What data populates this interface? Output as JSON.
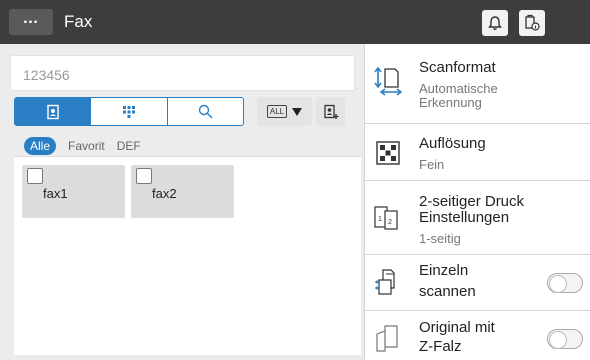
{
  "header": {
    "menu_label": "…",
    "title": "Fax"
  },
  "search": {
    "number_value": "123456"
  },
  "destination_tabs": {
    "all_label": "ALL"
  },
  "filters": [
    "Alle",
    "Favorit",
    "DEF"
  ],
  "destinations": [
    {
      "label": "fax1"
    },
    {
      "label": "fax2"
    }
  ],
  "settings": {
    "scan_format": {
      "title": "Scanformat",
      "value_line1": "Automatische",
      "value_line2": "Erkennung"
    },
    "resolution": {
      "title": "Auflösung",
      "value": "Fein"
    },
    "duplex": {
      "title_line1": "2-seitiger Druck",
      "title_line2": "Einstellungen",
      "value": "1-seitig"
    },
    "separate_scan": {
      "title_line1": "Einzeln",
      "title_line2": "scannen"
    },
    "z_fold": {
      "title_line1": "Original  mit",
      "title_line2": "Z-Falz"
    }
  },
  "colors": {
    "accent": "#2a7fc4",
    "topbar": "#3d3d3d"
  }
}
